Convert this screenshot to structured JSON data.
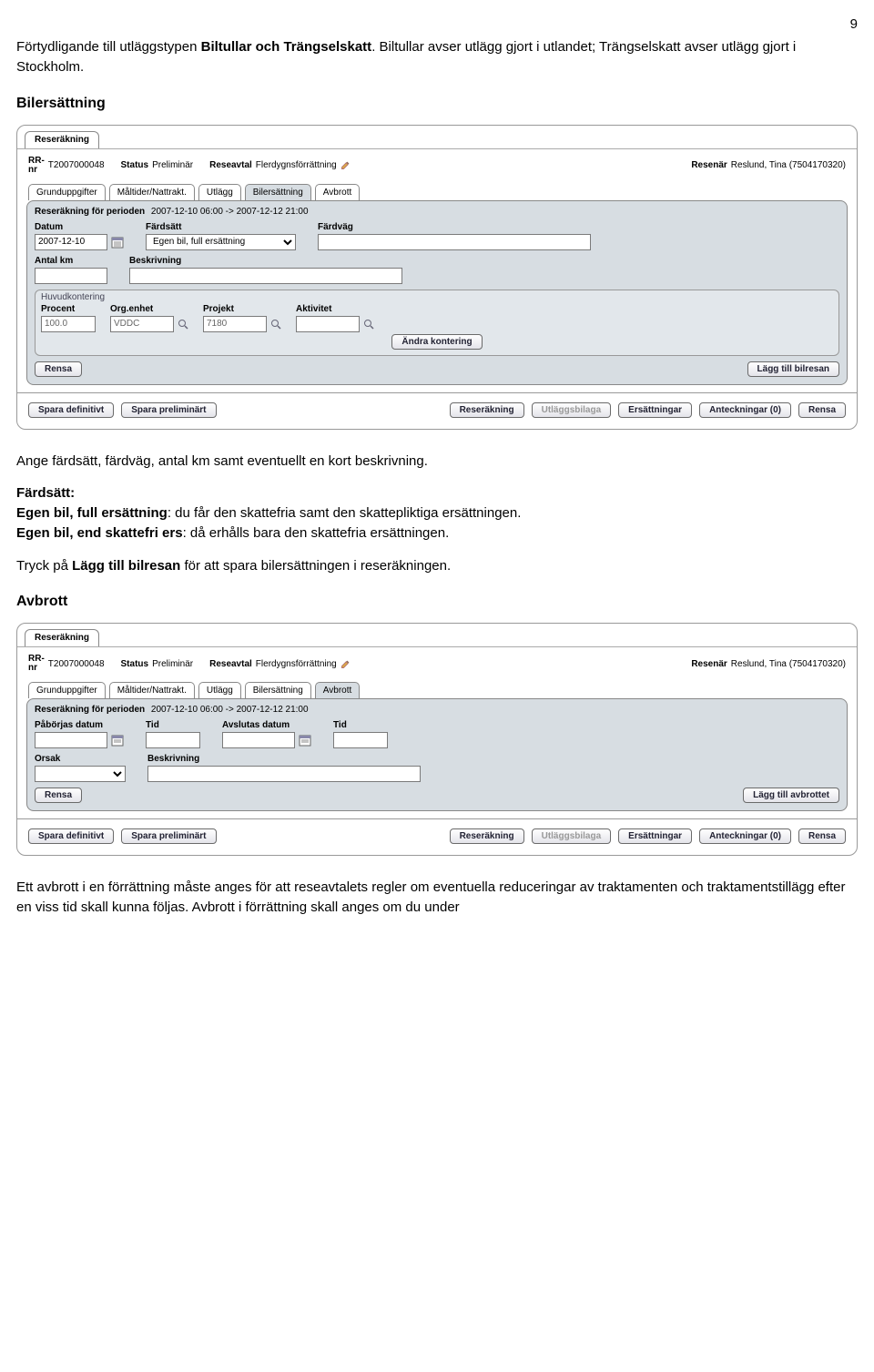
{
  "page_number": "9",
  "intro_pre": "Förtydligande till utläggstypen ",
  "intro_bold": "Biltullar och Trängselskatt",
  "intro_post": ". Biltullar avser utlägg gjort i utlandet; Trängselskatt avser utlägg gjort i Stockholm.",
  "sectionA_title": "Bilersättning",
  "sectionA_para1": "Ange färdsätt, färdväg, antal km samt eventuellt en kort beskrivning.",
  "sectionA_fardsatt_h": "Färdsätt:",
  "sectionA_line1_b": "Egen bil, full ersättning",
  "sectionA_line1_r": ": du får den skattefria samt den skattepliktiga ersättningen.",
  "sectionA_line2_b": "Egen bil, end skattefri ers",
  "sectionA_line2_r": ": då erhålls bara den skattefria ersättningen.",
  "sectionA_para3_pre": "Tryck på ",
  "sectionA_para3_b": "Lägg till bilresan",
  "sectionA_para3_post": " för att spara bilersättningen i reseräkningen.",
  "sectionB_title": "Avbrott",
  "sectionB_para": "Ett avbrott i en förrättning måste anges för att reseavtalets regler om eventuella reduceringar av traktamenten och traktamentstillägg efter en viss tid skall kunna följas. Avbrott i förrättning skall anges om du under",
  "shot": {
    "tab": "Reseräkning",
    "rrnr_label": "RR-\nnr",
    "rrnr_val": "T2007000048",
    "status_label": "Status",
    "status_val": "Preliminär",
    "reseavtal_label": "Reseavtal",
    "reseavtal_val": "Flerdygnsförrättning",
    "resenar_label": "Resenär",
    "resenar_val": "Reslund, Tina (7504170320)",
    "tabs": [
      "Grunduppgifter",
      "Måltider/Nattrakt.",
      "Utlägg",
      "Bilersättning",
      "Avbrott"
    ],
    "period_label": "Reseräkning för perioden",
    "period_val": "2007-12-10 06:00 -> 2007-12-12 21:00",
    "bil": {
      "datum_label": "Datum",
      "datum_val": "2007-12-10",
      "fardsatt_label": "Färdsätt",
      "fardsatt_val": "Egen bil, full ersättning",
      "fardvag_label": "Färdväg",
      "antalkm_label": "Antal km",
      "beskr_label": "Beskrivning",
      "hk_title": "Huvudkontering",
      "procent_label": "Procent",
      "procent_val": "100.0",
      "org_label": "Org.enhet",
      "org_val": "VDDC",
      "projekt_label": "Projekt",
      "projekt_val": "7180",
      "aktivitet_label": "Aktivitet",
      "andra_btn": "Ändra kontering",
      "rensa_btn": "Rensa",
      "laggtill_btn": "Lägg till bilresan"
    },
    "av": {
      "pa_datum_label": "Påbörjas datum",
      "tid_label": "Tid",
      "avsl_datum_label": "Avslutas datum",
      "tid2_label": "Tid",
      "orsak_label": "Orsak",
      "beskr_label": "Beskrivning",
      "rensa_btn": "Rensa",
      "laggtill_btn": "Lägg till avbrottet"
    },
    "foot_btns": [
      "Spara definitivt",
      "Spara preliminärt",
      "Reseräkning",
      "Utläggsbilaga",
      "Ersättningar",
      "Anteckningar (0)",
      "Rensa"
    ]
  }
}
